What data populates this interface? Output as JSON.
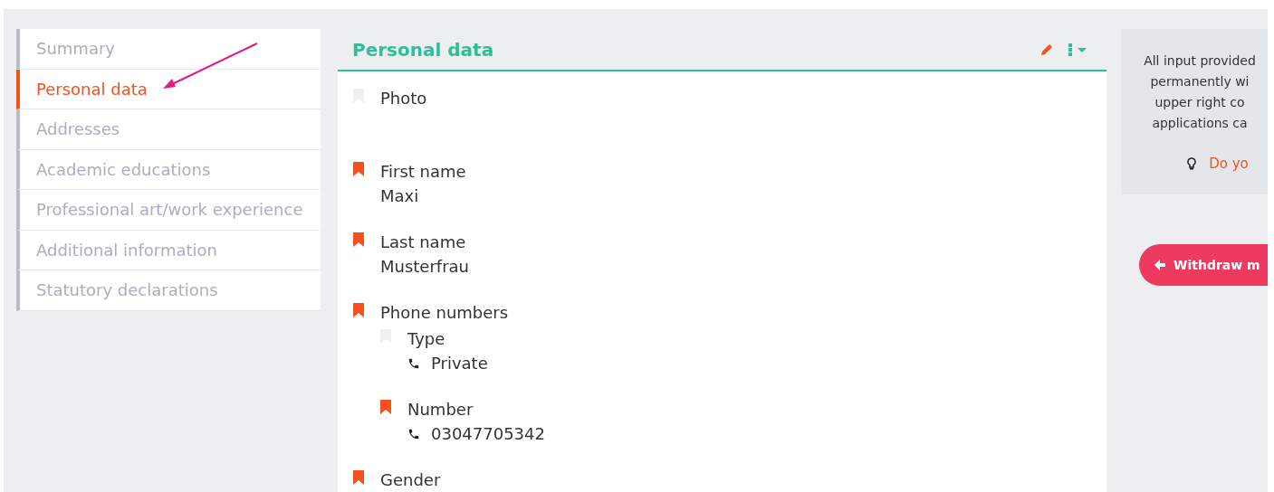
{
  "sidebar": {
    "items": [
      {
        "label": "Summary",
        "selected": false
      },
      {
        "label": "Personal data",
        "selected": true
      },
      {
        "label": "Addresses",
        "selected": false
      },
      {
        "label": "Academic educations",
        "selected": false
      },
      {
        "label": "Professional art/work experience",
        "selected": false
      },
      {
        "label": "Additional information",
        "selected": false
      },
      {
        "label": "Statutory declarations",
        "selected": false
      }
    ]
  },
  "panel": {
    "title": "Personal data",
    "fields": [
      {
        "label": "Photo",
        "required": false
      },
      {
        "label": "First name",
        "required": true,
        "value": "Maxi"
      },
      {
        "label": "Last name",
        "required": true,
        "value": "Musterfrau"
      },
      {
        "label": "Phone numbers",
        "required": true,
        "children": [
          {
            "label": "Type",
            "required": false,
            "value": "Private",
            "kind": "phone"
          },
          {
            "label": "Number",
            "required": true,
            "value": "03047705342",
            "kind": "phone"
          }
        ]
      },
      {
        "label": "Gender",
        "required": true
      }
    ]
  },
  "info": {
    "lines": [
      "All input provided",
      "permanently wi",
      "upper right co",
      "applications ca"
    ],
    "hint": "Do yo"
  },
  "withdraw_button": {
    "label": "Withdraw m"
  }
}
